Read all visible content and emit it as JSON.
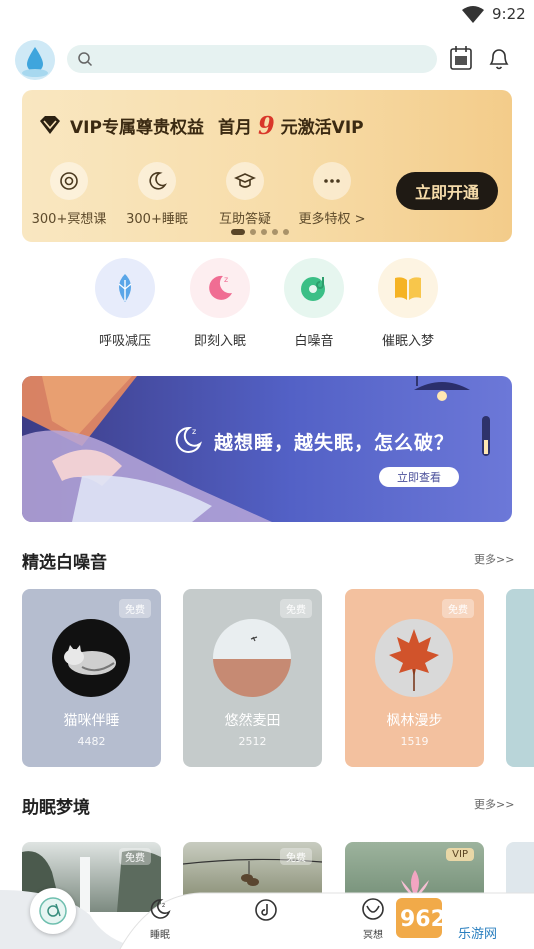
{
  "status_bar": {
    "time": "9:22"
  },
  "search": {
    "placeholder": ""
  },
  "vip": {
    "title": "VIP专属尊贵权益",
    "offer_prefix": "首月",
    "offer_price": "9",
    "offer_suffix": "元激活VIP",
    "perks": [
      "300+冥想课",
      "300+睡眠",
      "互助答疑",
      "更多特权 >"
    ],
    "button": "立即开通"
  },
  "quick_actions": [
    "呼吸减压",
    "即刻入眠",
    "白噪音",
    "催眠入梦"
  ],
  "banner": {
    "headline": "越想睡，越失眠，怎么破？",
    "cta": "立即查看"
  },
  "white_noise": {
    "title": "精选白噪音",
    "more": "更多>>",
    "items": [
      {
        "name": "猫咪伴睡",
        "count": "4482",
        "badge": "免费"
      },
      {
        "name": "悠然麦田",
        "count": "2512",
        "badge": "免费"
      },
      {
        "name": "枫林漫步",
        "count": "1519",
        "badge": "免费"
      }
    ]
  },
  "dreams": {
    "title": "助眠梦境",
    "more": "更多>>",
    "badges": [
      "免费",
      "免费",
      "VIP"
    ]
  },
  "tabbar": {
    "tabs": [
      "睡眠",
      "",
      "冥想"
    ]
  },
  "watermark": {
    "brand": "962.NET",
    "sub": "乐游网"
  },
  "colors": {
    "accent": "#1f1a14",
    "vip_gold": "#f7dca8",
    "banner_blue": "#5361c6"
  }
}
